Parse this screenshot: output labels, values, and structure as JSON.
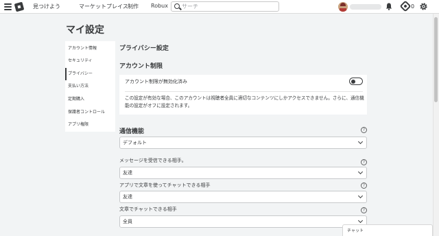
{
  "topbar": {
    "nav": [
      "見つけよう",
      "マーケットプレイス",
      "制作",
      "Robux"
    ],
    "search_placeholder": "サーチ",
    "robux_count": "0"
  },
  "page": {
    "title": "マイ設定"
  },
  "sidebar": {
    "items": [
      {
        "label": "アカウント情報"
      },
      {
        "label": "セキュリティ"
      },
      {
        "label": "プライバシー"
      },
      {
        "label": "支払い方法"
      },
      {
        "label": "定期購入"
      },
      {
        "label": "保護者コントロール"
      },
      {
        "label": "アプリ権限"
      }
    ],
    "active_index": 2
  },
  "privacy": {
    "section_title": "プライバシー設定",
    "account_restrictions": {
      "heading": "アカウント制限",
      "label": "アカウント制限が無効化済み",
      "enabled": false,
      "description": "この設定が有効な場合、このアカウントは視聴者全員に適切なコンテンツにしかアクセスできません。さらに、通信機能の設定がオフに設定されます。"
    },
    "communication": {
      "heading": "通信機能",
      "preset_value": "デフォルト",
      "fields": [
        {
          "label": "メッセージを受信できる相手。",
          "value": "友達"
        },
        {
          "label": "アプリで文章を使ってチャットできる相手",
          "value": "友達"
        },
        {
          "label": "文章でチャットできる相手",
          "value": "全員"
        }
      ]
    }
  },
  "chat": {
    "label": "チャット"
  },
  "colors": {
    "background": "#f2f4f5",
    "card": "#ffffff",
    "text": "#393b3d"
  }
}
